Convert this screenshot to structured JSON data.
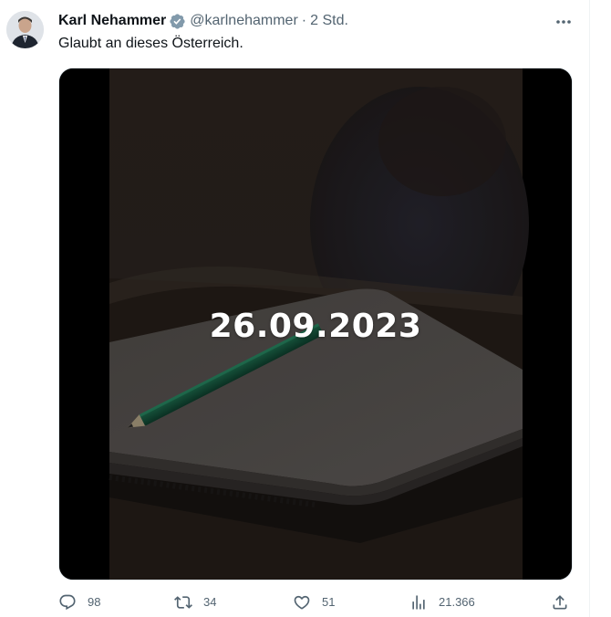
{
  "tweet": {
    "author_name": "Karl Nehammer",
    "handle": "@karlnehammer",
    "separator": "·",
    "time": "2 Std.",
    "text": "Glaubt an dieses Österreich.",
    "media_overlay_text": "26.09.2023"
  },
  "actions": {
    "replies": "98",
    "retweets": "34",
    "likes": "51",
    "views": "21.366"
  },
  "icons": {
    "verified": "verified-badge-icon",
    "more": "more-icon",
    "reply": "reply-icon",
    "retweet": "retweet-icon",
    "like": "heart-icon",
    "views": "views-icon",
    "share": "share-icon"
  },
  "colors": {
    "text_primary": "#0f1419",
    "text_secondary": "#536471",
    "verified_badge": "#829aab"
  }
}
